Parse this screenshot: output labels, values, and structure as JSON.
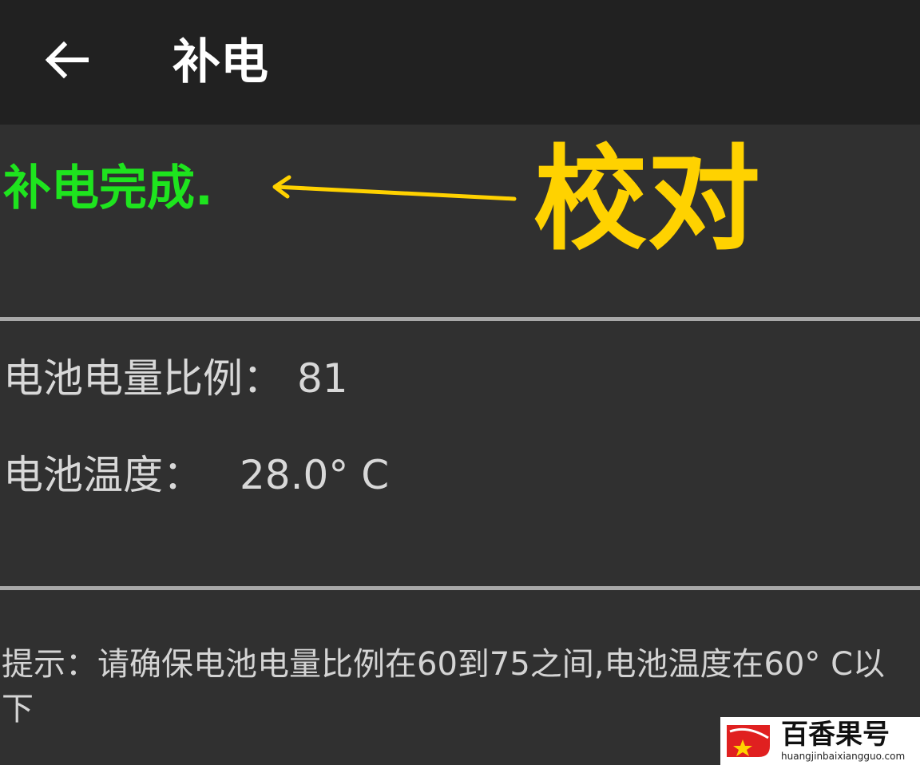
{
  "appbar": {
    "back_icon": "arrow-left-icon",
    "title": "补电"
  },
  "status": {
    "text": "补电完成.",
    "color": "#1ee41e"
  },
  "annotation": {
    "label": "校对",
    "color": "#ffd200",
    "arrow_icon": "arrow-left-icon"
  },
  "battery": {
    "level_label": "电池电量比例：",
    "level_value": "81",
    "temp_label": "电池温度：",
    "temp_value": "28.0° C"
  },
  "hint": {
    "text": "提示：请确保电池电量比例在60到75之间,电池温度在60° C以下"
  },
  "watermark": {
    "title": "百香果号",
    "url": "huangjinbaixiangguo.com",
    "logo_icon": "star-logo-icon",
    "accent": "#e02020"
  }
}
